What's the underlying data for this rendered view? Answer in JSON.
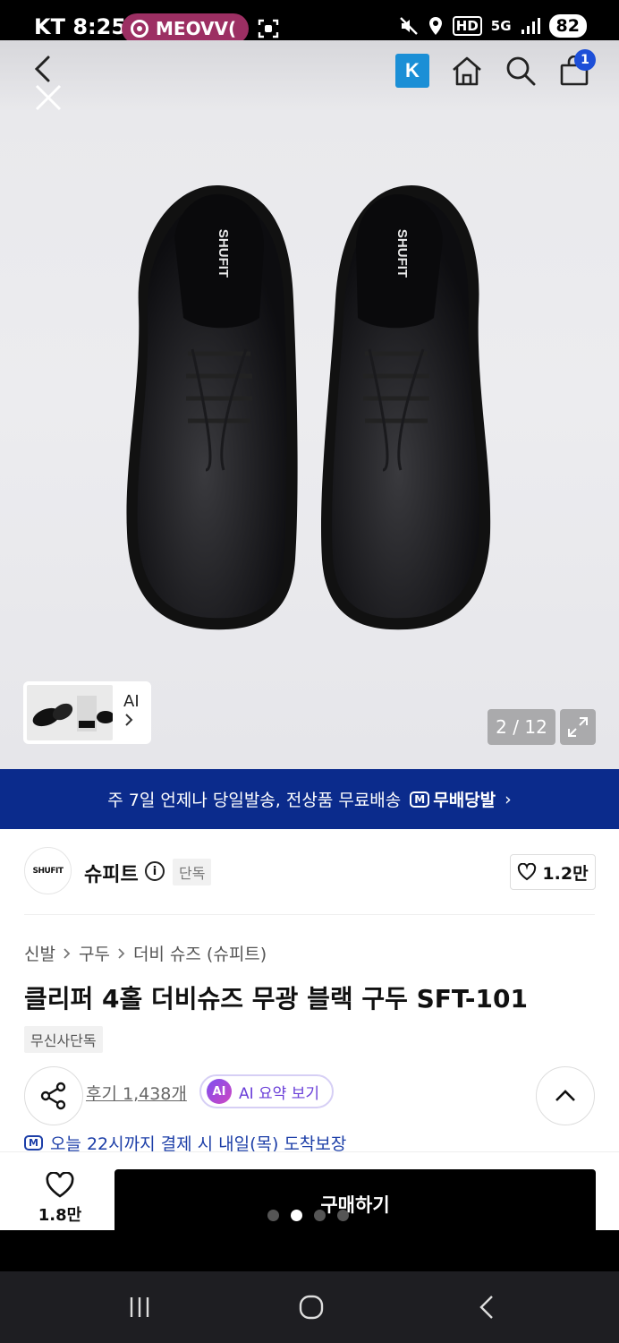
{
  "status_bar": {
    "carrier": "KT",
    "time": "8:25",
    "media_label": "MEOVV(",
    "hd": "HD",
    "network": "5G",
    "battery": "82"
  },
  "top_nav": {
    "k_badge": "K",
    "cart_count": "1"
  },
  "gallery": {
    "thumb_label": "AI",
    "pager": "2 / 12",
    "brand_imprint": "SHUFIT"
  },
  "banner": {
    "text": "주 7일 언제나 당일발송, 전상품 무료배송",
    "badge_logo": "M",
    "badge_label": "무배당발",
    "chevron": "›"
  },
  "brand": {
    "logo_text": "SHUFIT",
    "name": "슈피트",
    "info_glyph": "i",
    "tag": "단독",
    "like_count": "1.2만"
  },
  "product": {
    "breadcrumb": [
      "신발",
      "구두",
      "더비 슈즈 (슈피트)"
    ],
    "title": "클리퍼 4홀 더비슈즈 무광 블랙 구두 SFT-101",
    "exclusive_tag": "무신사단독",
    "review_link": "후기 1,438개",
    "ai_summary_icon": "AI",
    "ai_summary_label": "AI 요약 보기",
    "delivery_logo": "M",
    "delivery_text": "오늘 22시까지 결제 시 내일(목) 도착보장"
  },
  "action_bar": {
    "wish_count": "1.8만",
    "buy_label": "구매하기"
  },
  "colors": {
    "banner_bg": "#0b2b8c",
    "media_pill": "#9c2f63",
    "k_badge": "#1b8fd6",
    "ai_purple": "#6a3fd8"
  }
}
